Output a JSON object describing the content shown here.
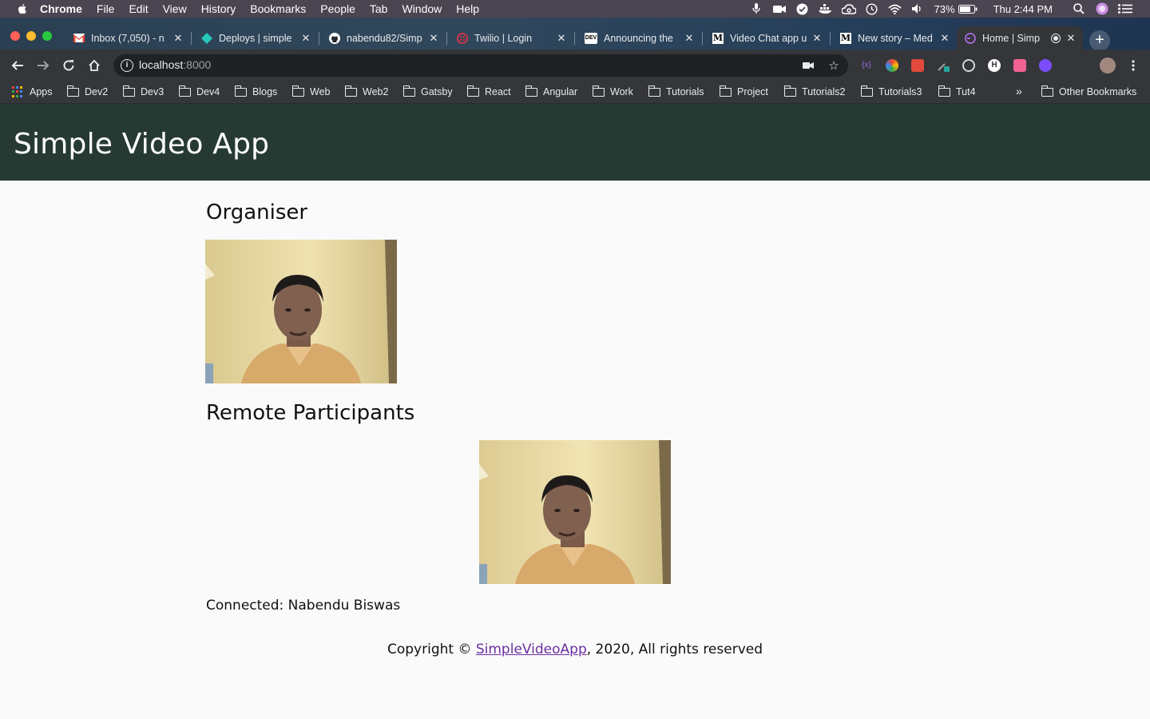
{
  "menubar": {
    "app_name": "Chrome",
    "items": [
      "File",
      "Edit",
      "View",
      "History",
      "Bookmarks",
      "People",
      "Tab",
      "Window",
      "Help"
    ],
    "battery": "73%",
    "clock": "Thu 2:44 PM"
  },
  "tabs": [
    {
      "title": "Inbox (7,050) - n",
      "favicon": "gmail-icon"
    },
    {
      "title": "Deploys | simple",
      "favicon": "netlify-icon"
    },
    {
      "title": "nabendu82/Simp",
      "favicon": "github-icon"
    },
    {
      "title": "Twilio | Login",
      "favicon": "twilio-icon"
    },
    {
      "title": "Announcing the",
      "favicon": "dev-icon",
      "favicon_text": "DEV"
    },
    {
      "title": "Video Chat app u",
      "favicon": "medium-icon",
      "favicon_text": "M"
    },
    {
      "title": "New story – Med",
      "favicon": "medium-icon",
      "favicon_text": "M"
    },
    {
      "title": "Home | Simp",
      "favicon": "gatsby-icon",
      "active": true
    }
  ],
  "address_bar": {
    "host": "localhost",
    "port": ":8000"
  },
  "bookmarks": {
    "apps_label": "Apps",
    "folders": [
      "Dev2",
      "Dev3",
      "Dev4",
      "Blogs",
      "Web",
      "Web2",
      "Gatsby",
      "React",
      "Angular",
      "Work",
      "Tutorials",
      "Project",
      "Tutorials2",
      "Tutorials3",
      "Tut4"
    ],
    "overflow": "»",
    "other": "Other Bookmarks"
  },
  "page": {
    "header_title": "Simple Video App",
    "organiser_heading": "Organiser",
    "remote_heading": "Remote Participants",
    "connected_status": "Connected: Nabendu Biswas",
    "footer_prefix": "Copyright © ",
    "footer_link": "SimpleVideoApp",
    "footer_suffix": ", 2020, All rights reserved"
  },
  "colors": {
    "header_bg": "#263a33",
    "link": "#6b2fa0",
    "chrome_toolbar": "#35363a"
  }
}
